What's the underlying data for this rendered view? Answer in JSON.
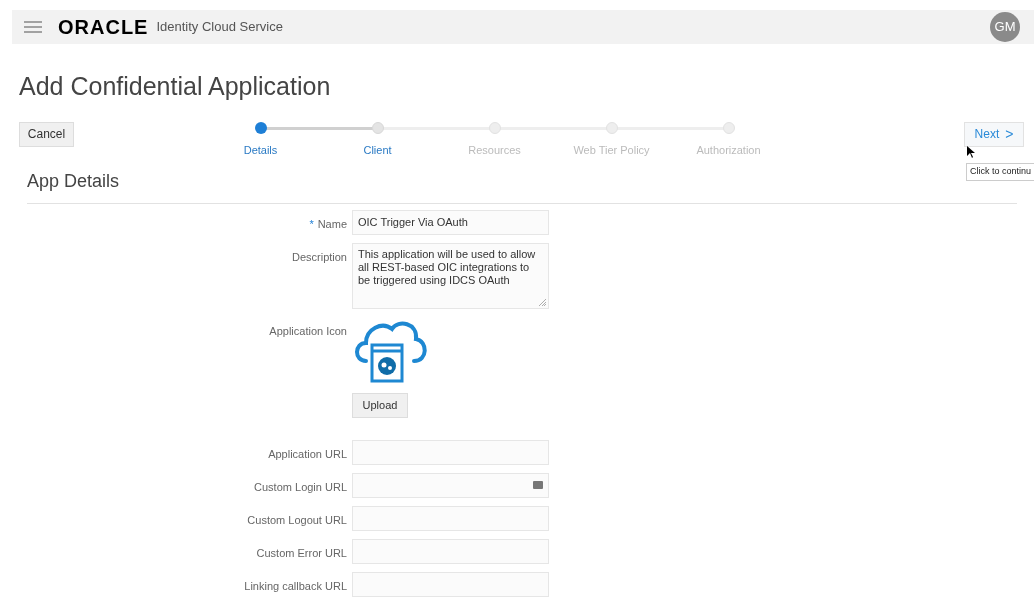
{
  "header": {
    "logo": "ORACLE",
    "product": "Identity Cloud Service",
    "avatar": "GM"
  },
  "page_title": "Add Confidential Application",
  "cancel_button": "Cancel",
  "steps": [
    {
      "label": "Details",
      "selected": true,
      "disabled": false
    },
    {
      "label": "Client",
      "selected": false,
      "disabled": false
    },
    {
      "label": "Resources",
      "selected": false,
      "disabled": true
    },
    {
      "label": "Web Tier Policy",
      "selected": false,
      "disabled": true
    },
    {
      "label": "Authorization",
      "selected": false,
      "disabled": true
    }
  ],
  "next_button": {
    "label": "Next",
    "chevron": ">"
  },
  "tooltip": "Click to continu",
  "section_title": "App Details",
  "fields": [
    {
      "kind": "text",
      "label": "Name",
      "required_mark": "*",
      "value": "OIC Trigger Via OAuth"
    },
    {
      "kind": "textarea",
      "label": "Description",
      "value": "This application will be used to allow all REST-based OIC integrations to be triggered using IDCS OAuth"
    },
    {
      "kind": "image",
      "label": "Application Icon",
      "button": "Upload"
    },
    {
      "kind": "text",
      "label": "Application URL"
    },
    {
      "kind": "text",
      "label": "Custom Login URL",
      "trailing_icon": true
    },
    {
      "kind": "text",
      "label": "Custom Logout URL"
    },
    {
      "kind": "text",
      "label": "Custom Error URL"
    },
    {
      "kind": "text",
      "label": "Linking callback URL"
    }
  ]
}
